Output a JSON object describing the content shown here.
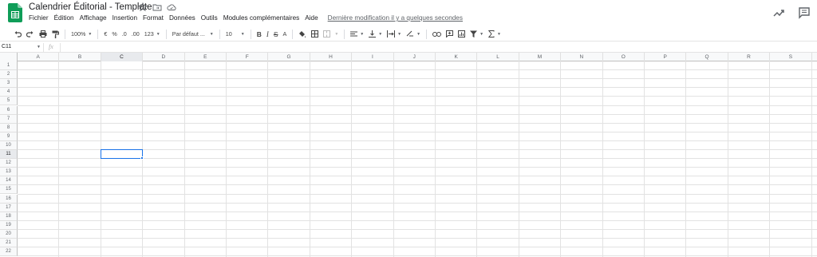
{
  "header": {
    "title": "Calendrier Éditorial - Template",
    "menu": [
      "Fichier",
      "Édition",
      "Affichage",
      "Insertion",
      "Format",
      "Données",
      "Outils",
      "Modules complémentaires",
      "Aide"
    ],
    "last_edit": "Dernière modification il y a quelques secondes"
  },
  "toolbar": {
    "zoom": "100%",
    "currency": "€",
    "percent": "%",
    "dec_decrease": ".0",
    "dec_increase": ".00",
    "number_format": "123",
    "font": "Par défaut ...",
    "font_size": "10",
    "bold": "B",
    "italic": "I",
    "strike": "S",
    "text_color": "A"
  },
  "formula_bar": {
    "name_box": "C11",
    "fx": "fx",
    "value": ""
  },
  "grid": {
    "columns": [
      "A",
      "B",
      "C",
      "D",
      "E",
      "F",
      "G",
      "H",
      "I",
      "J",
      "K",
      "L",
      "M",
      "N",
      "O",
      "P",
      "Q",
      "R",
      "S"
    ],
    "rows": [
      "1",
      "2",
      "3",
      "4",
      "5",
      "6",
      "7",
      "8",
      "9",
      "10",
      "11",
      "12",
      "13",
      "14",
      "15",
      "16",
      "17",
      "18",
      "19",
      "20",
      "21",
      "22"
    ],
    "selected_cell": "C11"
  },
  "colors": {
    "sheets_green": "#0f9d58",
    "selection_blue": "#1a73e8"
  }
}
